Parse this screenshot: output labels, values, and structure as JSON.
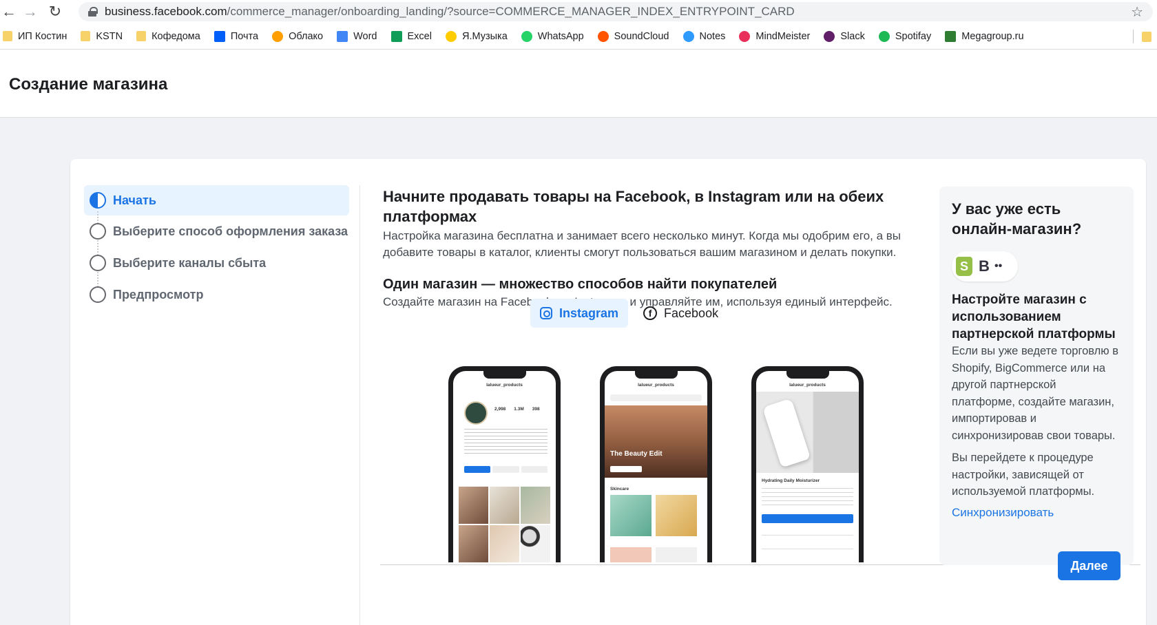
{
  "browser": {
    "url_host": "business.facebook.com",
    "url_path": "/commerce_manager/onboarding_landing/?source=COMMERCE_MANAGER_INDEX_ENTRYPOINT_CARD",
    "bookmarks": [
      {
        "label": "ИП Костин",
        "icon": "folder-icon",
        "color": "#f7d26b"
      },
      {
        "label": "KSTN",
        "icon": "folder-icon",
        "color": "#f7d26b"
      },
      {
        "label": "Кофедома",
        "icon": "folder-icon",
        "color": "#f7d26b"
      },
      {
        "label": "Почта",
        "icon": "mail-icon",
        "color": "#005ff9"
      },
      {
        "label": "Облако",
        "icon": "cloud-icon",
        "color": "#ff9e00"
      },
      {
        "label": "Word",
        "icon": "word-icon",
        "color": "#4285f4"
      },
      {
        "label": "Excel",
        "icon": "sheets-icon",
        "color": "#0f9d58"
      },
      {
        "label": "Я.Музыка",
        "icon": "yandex-music-icon",
        "color": "#ffcc00"
      },
      {
        "label": "WhatsApp",
        "icon": "whatsapp-icon",
        "color": "#25d366"
      },
      {
        "label": "SoundCloud",
        "icon": "soundcloud-icon",
        "color": "#ff5500"
      },
      {
        "label": "Notes",
        "icon": "notes-icon",
        "color": "#2f9bff"
      },
      {
        "label": "MindMeister",
        "icon": "mindmeister-icon",
        "color": "#e8305a"
      },
      {
        "label": "Slack",
        "icon": "slack-icon",
        "color": "#611f69"
      },
      {
        "label": "Spotifay",
        "icon": "spotify-icon",
        "color": "#1db954"
      },
      {
        "label": "Megagroup.ru",
        "icon": "megagroup-icon",
        "color": "#2e7d32"
      }
    ]
  },
  "header": {
    "title": "Создание магазина"
  },
  "steps": [
    {
      "label": "Начать",
      "active": true
    },
    {
      "label": "Выберите способ оформления заказа",
      "active": false
    },
    {
      "label": "Выберите каналы сбыта",
      "active": false
    },
    {
      "label": "Предпросмотр",
      "active": false
    }
  ],
  "main": {
    "title": "Начните продавать товары на Facebook, в Instagram или на обеих платформах",
    "description": "Настройка магазина бесплатна и занимает всего несколько минут. Когда мы одобрим его, а вы добавите товары в каталог, клиенты смогут пользоваться вашим магазином и делать покупки.",
    "subtitle": "Один магазин — множество способов найти покупателей",
    "subdescription": "Создайте магазин на Facebook и в Instagram и управляйте им, используя единый интерфейс.",
    "toggle": {
      "instagram": "Instagram",
      "facebook": "Facebook",
      "selected": "Instagram"
    },
    "phones": {
      "profile_name": "lalueur_products",
      "stats": [
        "2,998",
        "1.3M",
        "398"
      ],
      "hero_title": "The Beauty Edit",
      "section": "Skincare",
      "product_name": "Hydrating Daily Moisturizer"
    }
  },
  "side": {
    "title": "У вас уже есть онлайн-магазин?",
    "subtitle": "Настройте магазин с использованием партнерской платформы",
    "text1": "Если вы уже ведете торговлю в Shopify, BigCommerce или на другой партнерской платформе, создайте магазин, импортировав и синхронизировав свои товары.",
    "text2": "Вы перейдете к процедуре настройки, зависящей от используемой платформы.",
    "link": "Синхронизировать"
  },
  "footer": {
    "next_label": "Далее"
  },
  "colors": {
    "accent": "#1b74e4",
    "active_bg": "#e7f3ff"
  }
}
